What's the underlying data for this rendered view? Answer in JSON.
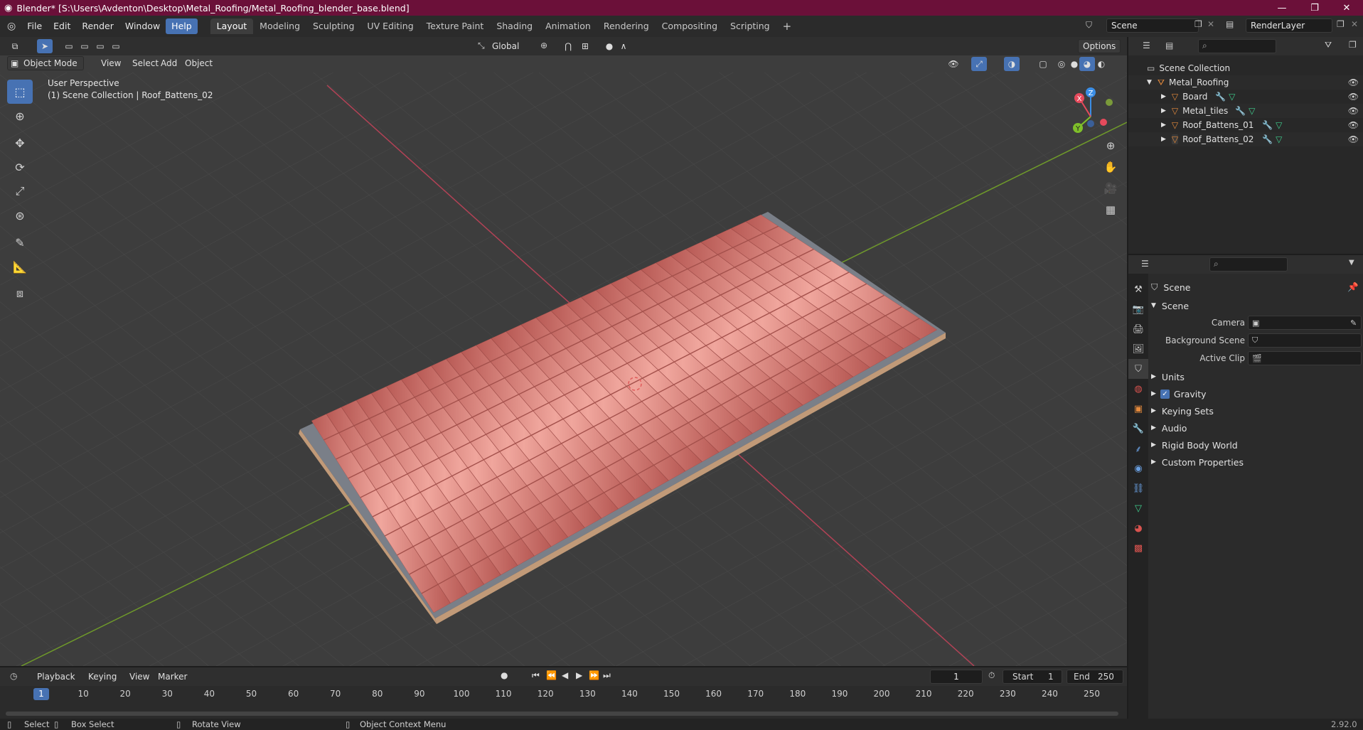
{
  "window": {
    "title": "Blender* [S:\\Users\\Avdenton\\Desktop\\Metal_Roofing/Metal_Roofing_blender_base.blend]",
    "minimize": "—",
    "maximize": "❐",
    "close": "✕"
  },
  "menu": [
    "File",
    "Edit",
    "Render",
    "Window",
    "Help"
  ],
  "workspaces": [
    "Layout",
    "Modeling",
    "Sculpting",
    "UV Editing",
    "Texture Paint",
    "Shading",
    "Animation",
    "Rendering",
    "Compositing",
    "Scripting"
  ],
  "add_workspace": "+",
  "scene_field": "Scene",
  "view_layer_field": "RenderLayer",
  "viewport": {
    "mode": "Object Mode",
    "menus": [
      "View",
      "Select",
      "Add",
      "Object"
    ],
    "transform_orientation": "Global",
    "options": "Options",
    "perspective": "User Perspective",
    "collection_info": "(1) Scene Collection | Roof_Battens_02",
    "gizmo_axes": {
      "x": "X",
      "y": "Y",
      "z": "Z"
    }
  },
  "outliner": {
    "root": "Scene Collection",
    "collection": "Metal_Roofing",
    "objects": [
      "Board",
      "Metal_tiles",
      "Roof_Battens_01",
      "Roof_Battens_02"
    ]
  },
  "properties": {
    "context": "Scene",
    "panel": "Scene",
    "fields": [
      {
        "label": "Camera"
      },
      {
        "label": "Background Scene"
      },
      {
        "label": "Active Clip"
      }
    ],
    "sections": [
      "Units",
      "Gravity",
      "Keying Sets",
      "Audio",
      "Rigid Body World",
      "Custom Properties"
    ],
    "gravity_checked": true
  },
  "timeline": {
    "menus": [
      "Playback",
      "Keying",
      "View",
      "Marker"
    ],
    "current_frame": "1",
    "start_label": "Start",
    "start": "1",
    "end_label": "End",
    "end": "250",
    "ticks": [
      "10",
      "20",
      "30",
      "40",
      "50",
      "60",
      "70",
      "80",
      "90",
      "100",
      "110",
      "120",
      "130",
      "140",
      "150",
      "160",
      "170",
      "180",
      "190",
      "200",
      "210",
      "220",
      "230",
      "240",
      "250"
    ]
  },
  "statusbar": {
    "select": "Select",
    "box_select": "Box Select",
    "rotate_view": "Rotate View",
    "context_menu": "Object Context Menu",
    "version": "2.92.0"
  },
  "colors": {
    "title_bar": "#6b1039",
    "accent": "#4772b3",
    "tile": "#d97a72",
    "x_axis": "#e64a5c",
    "y_axis": "#7fbf2a",
    "z_axis": "#3b8ee6"
  }
}
